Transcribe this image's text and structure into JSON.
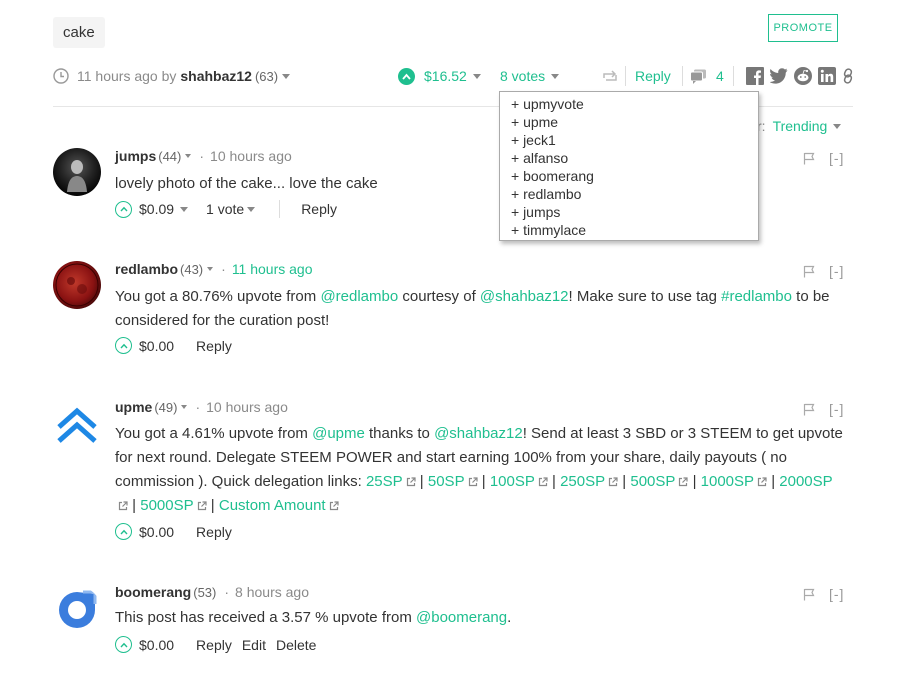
{
  "post": {
    "tag": "cake",
    "promote_label": "PROMOTE",
    "time": "11 hours ago by",
    "author": "shahbaz12",
    "author_rep": "(63)",
    "payout": "$16.52",
    "votes_label": "8 votes",
    "reply_label": "Reply",
    "comment_count": "4"
  },
  "voters": [
    "+ upmyvote",
    "+ upme",
    "+ jeck1",
    "+ alfanso",
    "+ boomerang",
    "+ redlambo",
    "+ jumps",
    "+ timmylace"
  ],
  "sort": {
    "label_partial": "r:",
    "value": "Trending"
  },
  "comments": [
    {
      "author": "jumps",
      "rep": "(44)",
      "time": "10 hours ago",
      "body": "lovely photo of the cake... love the cake",
      "payout": "$0.09",
      "votes": "1 vote",
      "reply": "Reply"
    },
    {
      "author": "redlambo",
      "rep": "(43)",
      "time": "11 hours ago",
      "body_parts": {
        "t1": "You got a 80.76% upvote from ",
        "l1": "@redlambo",
        "t2": " courtesy of ",
        "l2": "@shahbaz12",
        "t3": "! Make sure to use tag ",
        "l3": "#redlambo",
        "t4": " to be considered for the curation post!"
      },
      "payout": "$0.00",
      "reply": "Reply"
    },
    {
      "author": "upme",
      "rep": "(49)",
      "time": "10 hours ago",
      "body_parts": {
        "t1": "You got a 4.61% upvote from ",
        "l1": "@upme",
        "t2": " thanks to ",
        "l2": "@shahbaz12",
        "t3": "! Send at least 3 SBD or 3 STEEM to get upvote for next round. Delegate STEEM POWER and start earning 100% from your share, daily payouts ( no commission ). Quick delegation links: "
      },
      "links": [
        "25SP",
        "50SP",
        "100SP",
        "250SP",
        "500SP",
        "1000SP",
        "2000SP",
        "5000SP",
        "Custom Amount"
      ],
      "payout": "$0.00",
      "reply": "Reply"
    },
    {
      "author": "boomerang",
      "rep": "(53)",
      "time": "8 hours ago",
      "body_parts": {
        "t1": "This post has received a 3.57 % upvote from ",
        "l1": "@boomerang",
        "t2": "."
      },
      "payout": "$0.00",
      "reply": "Reply",
      "edit": "Edit",
      "delete": "Delete"
    }
  ],
  "colors": {
    "accent": "#1fbf8f",
    "muted": "#8a8a8a",
    "text": "#333333",
    "upme_blue": "#1e88e5",
    "boomerang_blue": "#3b7ddd"
  },
  "icons": [
    "clock-icon",
    "upvote-icon",
    "resteem-icon",
    "comments-icon",
    "facebook-icon",
    "twitter-icon",
    "reddit-icon",
    "linkedin-icon",
    "link-icon",
    "flag-icon",
    "external-link-icon"
  ]
}
